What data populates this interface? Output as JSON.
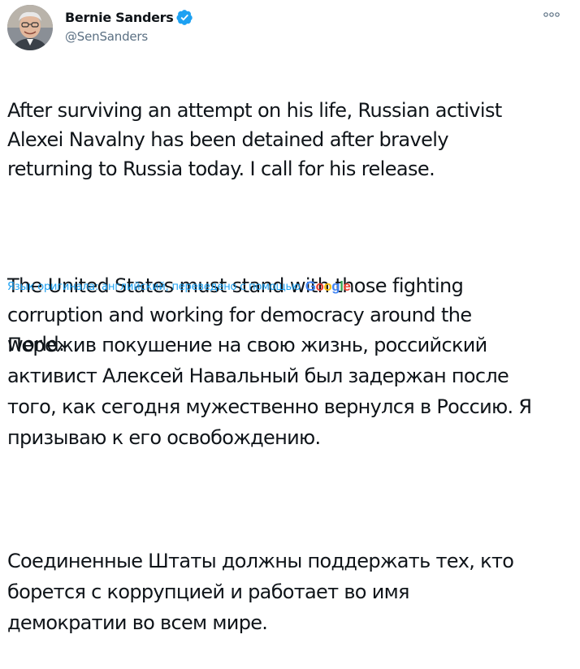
{
  "author": {
    "display_name": "Bernie Sanders",
    "handle": "@SenSanders",
    "verified": true
  },
  "tweet": {
    "paragraphs_en": [
      "After surviving an attempt on his life, Russian activist\nAlexei Navalny has been detained after bravely\nreturning to Russia today. I call for his release.",
      "The United States must stand with those fighting\ncorruption and working for democracy around the\nworld."
    ],
    "translation_note": "Язык оригинала: английский, переведено с помощью",
    "translation_provider": "Google",
    "paragraphs_ru": [
      "Пережив покушение на свою жизнь, российский\nактивист Алексей Навальный был задержан после\nтого, как сегодня мужественно вернулся в Россию. Я\nпризываю к его освобождению.",
      " Соединенные Штаты должны поддержать тех, кто\nборется с коррупцией и работает во имя\nдемократии во всем мире."
    ]
  },
  "colors": {
    "text": "#0f1419",
    "secondary": "#5b7083",
    "link": "#1da1f2",
    "verified": "#1da1f2",
    "google_blue": "#4285f4",
    "google_red": "#ea4335",
    "google_yellow": "#fbbc05",
    "google_green": "#34a853"
  },
  "icons": {
    "verified": "verified-badge-icon",
    "more": "more-options-icon"
  }
}
